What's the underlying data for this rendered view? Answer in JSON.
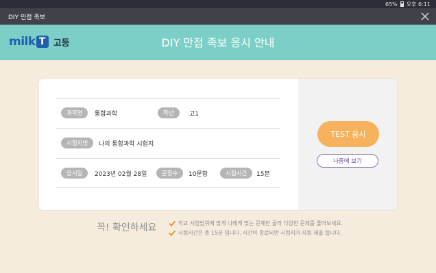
{
  "status_bar": {
    "battery": "65%",
    "time": "오후 6:11"
  },
  "window": {
    "title": "DIY 만점 족보"
  },
  "header": {
    "logo_milk": "milk",
    "logo_t": "T",
    "logo_grade": "고등",
    "title": "DIY 만점 족보 응시 안내"
  },
  "info": {
    "subject_label": "과목명",
    "subject_value": "통합과학",
    "grade_label": "학년",
    "grade_value": "고1",
    "exam_name_label": "시험지명",
    "exam_name_value": "나의 통합과학 시험지",
    "date_label": "응시일",
    "date_value": "2023년 02월 28일",
    "questions_label": "문항수",
    "questions_value": "10문항",
    "time_label": "시험시간",
    "time_value": "15분"
  },
  "actions": {
    "test_button": "TEST 응시",
    "later_button": "나중에 보기"
  },
  "notice": {
    "title": "꼭! 확인하세요",
    "items": [
      "학교 시험범위에 맞게 나에게 맞는 문제만 골라 다양한 문제를 풀어보세요.",
      "시험시간은 총 15분 입니다. 시간이 종료되면 시험지가 자동 제출 됩니다."
    ]
  },
  "colors": {
    "header_bg": "#7ccfc6",
    "page_bg": "#f5ecdd",
    "accent_button": "#f6b25c",
    "secondary_border": "#8d6fb8",
    "check_color": "#f08a1c"
  }
}
